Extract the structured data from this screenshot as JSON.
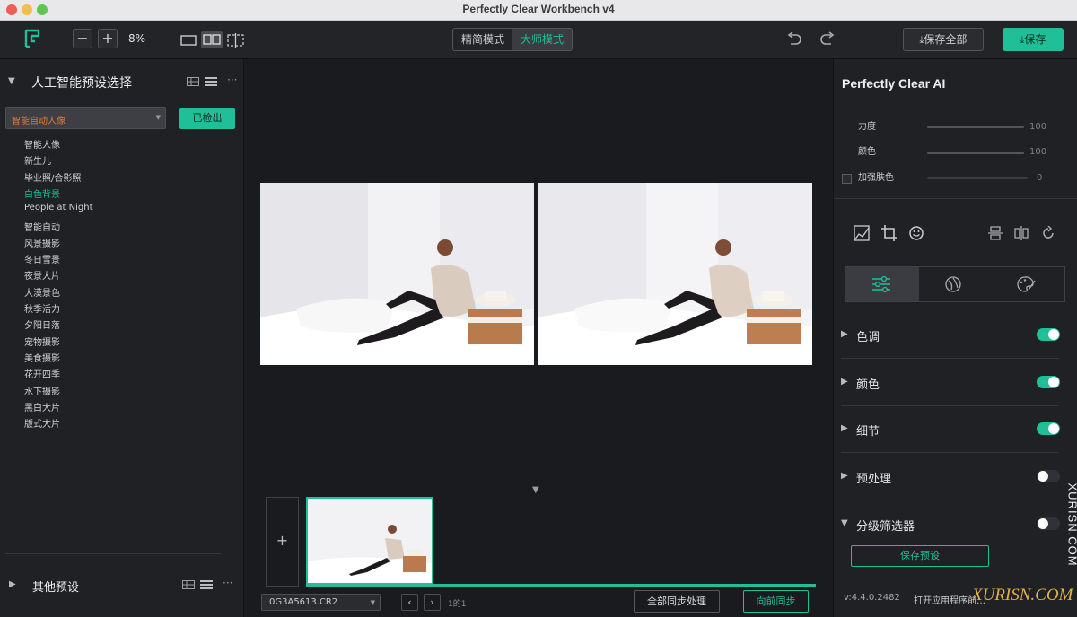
{
  "window": {
    "title": "Perfectly Clear Workbench v4"
  },
  "toolbar": {
    "zoom": "8%",
    "mode_simple": "精简模式",
    "mode_master": "大师模式",
    "save_all": "保存全部",
    "save": "保存"
  },
  "left": {
    "header": "人工智能预设选择",
    "dropdown_value": "智能自动人像",
    "checkout_button": "已检出",
    "presets": [
      "智能人像",
      "新生儿",
      "毕业照/合影照",
      "白色背景",
      "People at Night",
      "智能自动",
      "风景摄影",
      "冬日雪景",
      "夜景大片",
      "大漠景色",
      "秋季活力",
      "夕阳日落",
      "宠物摄影",
      "美食摄影",
      "花开四季",
      "水下摄影",
      "黑白大片",
      "版式大片"
    ],
    "active_preset_index": 3,
    "other_presets": "其他预设"
  },
  "center": {
    "filename": "0G3A5613.CR2",
    "page_count": "1的1",
    "sync_all_button": "全部同步处理",
    "sync_forward_button": "向前同步"
  },
  "right": {
    "title": "Perfectly Clear AI",
    "sliders": [
      {
        "label": "力度",
        "value": "100",
        "fraction": 1.0
      },
      {
        "label": "颜色",
        "value": "100",
        "fraction": 1.0
      },
      {
        "label": "加强肤色",
        "value": "0",
        "fraction": 0.0
      }
    ],
    "sections": [
      {
        "label": "色调",
        "on": true
      },
      {
        "label": "颜色",
        "on": true
      },
      {
        "label": "细节",
        "on": true
      },
      {
        "label": "预处理",
        "on": false
      },
      {
        "label": "分级筛选器",
        "on": false
      }
    ],
    "save_preset_button": "保存预设",
    "version": "v:4.4.0.2482",
    "open_app_text": "打开应用程序前…"
  },
  "watermark": {
    "vertical": "XURISN.COM",
    "bottom": "XURISN.COM"
  },
  "colors": {
    "accent": "#1fbf98",
    "orange": "#e07b39",
    "toggle_off": "#2f3236"
  }
}
